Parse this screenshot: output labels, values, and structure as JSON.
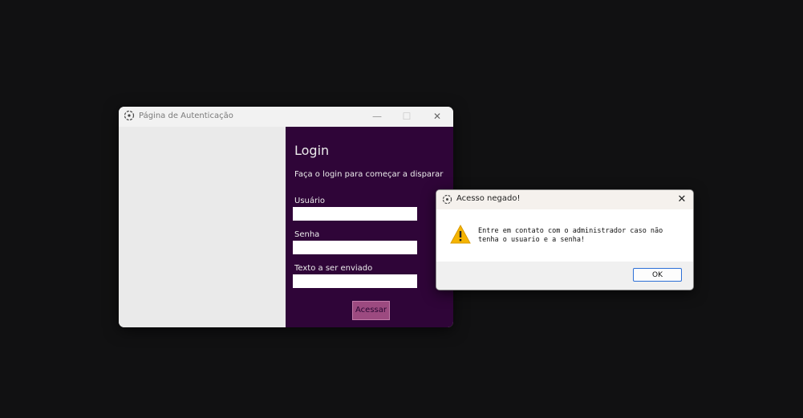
{
  "main_window": {
    "title": "Página de Autenticação",
    "controls": {
      "minimize": "—",
      "maximize": "☐",
      "close": "✕"
    },
    "login_title": "Login",
    "subtitle": "Faça o login para começar a disparar",
    "fields": [
      {
        "label": "Usuário",
        "value": ""
      },
      {
        "label": "Senha",
        "value": ""
      },
      {
        "label": "Texto a ser enviado",
        "value": ""
      }
    ],
    "submit_label": "Acessar"
  },
  "dialog": {
    "title": "Acesso negado!",
    "close": "✕",
    "message": "Entre em contato com o administrador caso não tenha o usuario e a senha!",
    "ok_label": "OK"
  },
  "colors": {
    "desktop_bg": "#111112",
    "panel_purple": "#2f0538",
    "button_pink": "#9c4a80",
    "ok_border": "#2c6fd6",
    "warning_yellow": "#f5b400"
  },
  "icons": [
    "app-icon",
    "warning-icon",
    "close-icon",
    "minimize-icon",
    "maximize-icon"
  ]
}
